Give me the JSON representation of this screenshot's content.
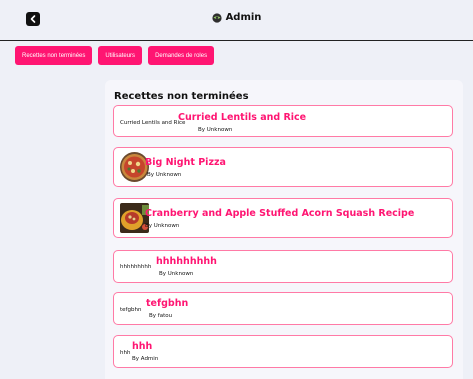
{
  "header": {
    "title": "Admin"
  },
  "nav": {
    "items": [
      {
        "label": "Recettes non terminées"
      },
      {
        "label": "Utilisateurs"
      },
      {
        "label": "Demandes de roles"
      }
    ]
  },
  "panel": {
    "title": "Recettes non terminées",
    "recipes": [
      {
        "prefix": "Curried Lentils and Rice",
        "title": "Curried Lentils and Rice",
        "author": "By Unknown"
      },
      {
        "prefix": "",
        "title": "Big Night Pizza",
        "author": "By Unknown"
      },
      {
        "prefix": "",
        "title": "Cranberry and Apple Stuffed Acorn Squash Recipe",
        "author": "By Unknown"
      },
      {
        "prefix": "hhhhhhhhh",
        "title": "hhhhhhhhh",
        "author": "By Unknown"
      },
      {
        "prefix": "tefgbhn",
        "title": "tefgbhn",
        "author": "By fatou"
      },
      {
        "prefix": "hhh",
        "title": "hhh",
        "author": "By Admin"
      }
    ]
  },
  "colors": {
    "accent": "#ff1572",
    "card_border": "#ff7aa6",
    "background": "#eef0f7"
  }
}
